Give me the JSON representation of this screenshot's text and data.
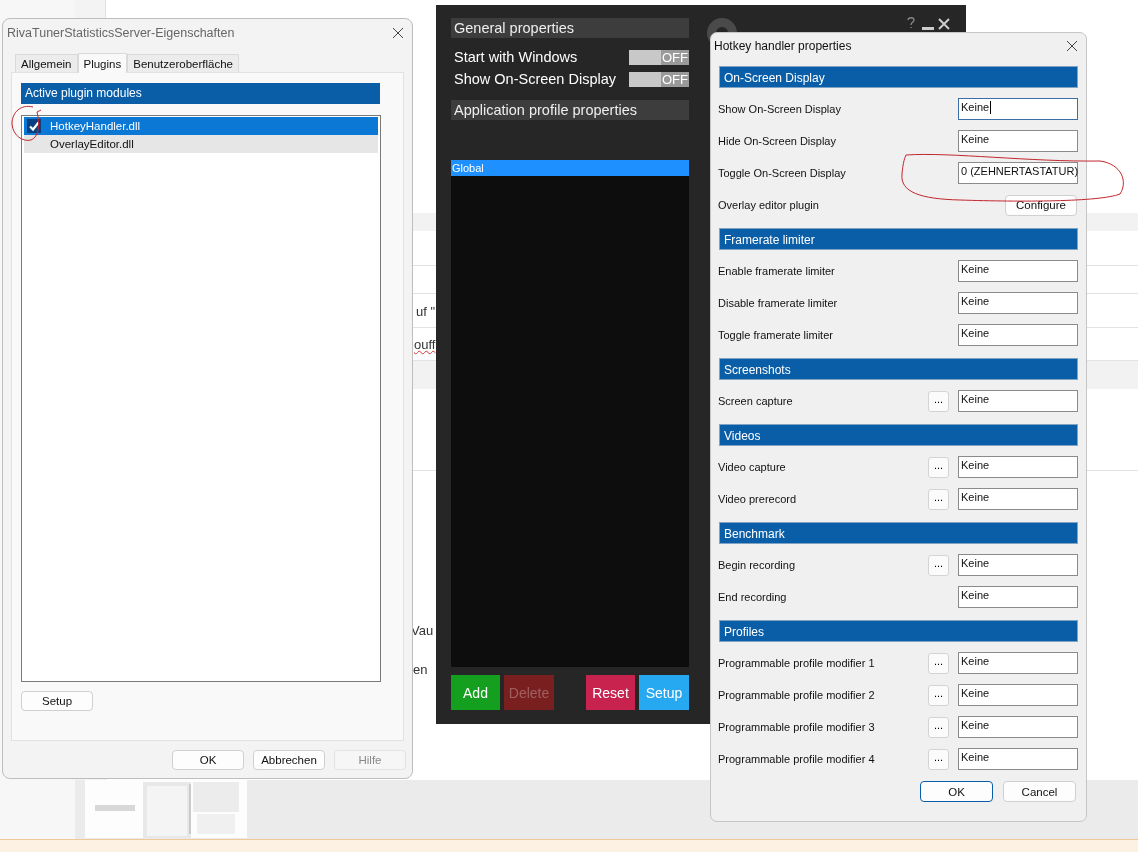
{
  "background_page": {
    "fragments": [
      "uf \"",
      "ouff",
      "Vau",
      "en"
    ]
  },
  "properties_dialog": {
    "title": "RivaTunerStatisticsServer-Eigenschaften",
    "tabs": [
      {
        "label": "Allgemein",
        "selected": false
      },
      {
        "label": "Plugins",
        "selected": true
      },
      {
        "label": "Benutzeroberfläche",
        "selected": false
      }
    ],
    "list_header": "Active plugin modules",
    "plugins": [
      {
        "name": "HotkeyHandler.dll",
        "checked": true,
        "selected": true
      },
      {
        "name": "OverlayEditor.dll",
        "checked": false,
        "selected": false
      }
    ],
    "setup_button": "Setup",
    "buttons": [
      {
        "label": "OK",
        "disabled": false
      },
      {
        "label": "Abbrechen",
        "disabled": false
      },
      {
        "label": "Hilfe",
        "disabled": true
      }
    ]
  },
  "rtss_window": {
    "general_header": "General properties",
    "settings": [
      {
        "label": "Start with Windows",
        "on": false,
        "state_text": "OFF"
      },
      {
        "label": "Show On-Screen Display",
        "on": false,
        "state_text": "OFF"
      }
    ],
    "profile_header": "Application profile properties",
    "profiles": [
      {
        "name": "Global",
        "selected": true
      }
    ],
    "buttons": [
      {
        "label": "Add",
        "color": "#14a01e",
        "disabled": false
      },
      {
        "label": "Delete",
        "color": "#7a1f1f",
        "disabled": true
      },
      {
        "label": "Reset",
        "color": "#c8234e",
        "disabled": false
      },
      {
        "label": "Setup",
        "color": "#27a9f1",
        "disabled": false
      }
    ]
  },
  "hotkey_dialog": {
    "title": "Hotkey handler properties",
    "sections": [
      {
        "title": "On-Screen Display",
        "rows": [
          {
            "kind": "hotkey",
            "label": "Show On-Screen Display",
            "value": "Keine",
            "focused": true
          },
          {
            "kind": "hotkey",
            "label": "Hide On-Screen Display",
            "value": "Keine",
            "focused": false
          },
          {
            "kind": "hotkey",
            "label": "Toggle On-Screen Display",
            "value": "0 (ZEHNERTASTATUR)",
            "focused": false
          },
          {
            "kind": "action",
            "label": "Overlay editor plugin",
            "button": "Configure"
          }
        ]
      },
      {
        "title": "Framerate limiter",
        "rows": [
          {
            "kind": "hotkey",
            "label": "Enable framerate limiter",
            "value": "Keine",
            "focused": false
          },
          {
            "kind": "hotkey",
            "label": "Disable framerate limiter",
            "value": "Keine",
            "focused": false
          },
          {
            "kind": "hotkey",
            "label": "Toggle framerate limiter",
            "value": "Keine",
            "focused": false
          }
        ]
      },
      {
        "title": "Screenshots",
        "rows": [
          {
            "kind": "hotkey",
            "label": "Screen capture",
            "browse": "...",
            "value": "Keine",
            "focused": false
          }
        ]
      },
      {
        "title": "Videos",
        "rows": [
          {
            "kind": "hotkey",
            "label": "Video capture",
            "browse": "...",
            "value": "Keine",
            "focused": false
          },
          {
            "kind": "hotkey",
            "label": "Video prerecord",
            "browse": "...",
            "value": "Keine",
            "focused": false
          }
        ]
      },
      {
        "title": "Benchmark",
        "rows": [
          {
            "kind": "hotkey",
            "label": "Begin recording",
            "browse": "...",
            "value": "Keine",
            "focused": false
          },
          {
            "kind": "hotkey",
            "label": "End recording",
            "value": "Keine",
            "focused": false
          }
        ]
      },
      {
        "title": "Profiles",
        "rows": [
          {
            "kind": "hotkey",
            "label": "Programmable profile modifier 1",
            "browse": "...",
            "value": "Keine",
            "focused": false
          },
          {
            "kind": "hotkey",
            "label": "Programmable profile modifier 2",
            "browse": "...",
            "value": "Keine",
            "focused": false
          },
          {
            "kind": "hotkey",
            "label": "Programmable profile modifier 3",
            "browse": "...",
            "value": "Keine",
            "focused": false
          },
          {
            "kind": "hotkey",
            "label": "Programmable profile modifier 4",
            "browse": "...",
            "value": "Keine",
            "focused": false
          }
        ]
      }
    ],
    "buttons": [
      {
        "label": "OK",
        "default": true
      },
      {
        "label": "Cancel",
        "default": false
      }
    ]
  }
}
